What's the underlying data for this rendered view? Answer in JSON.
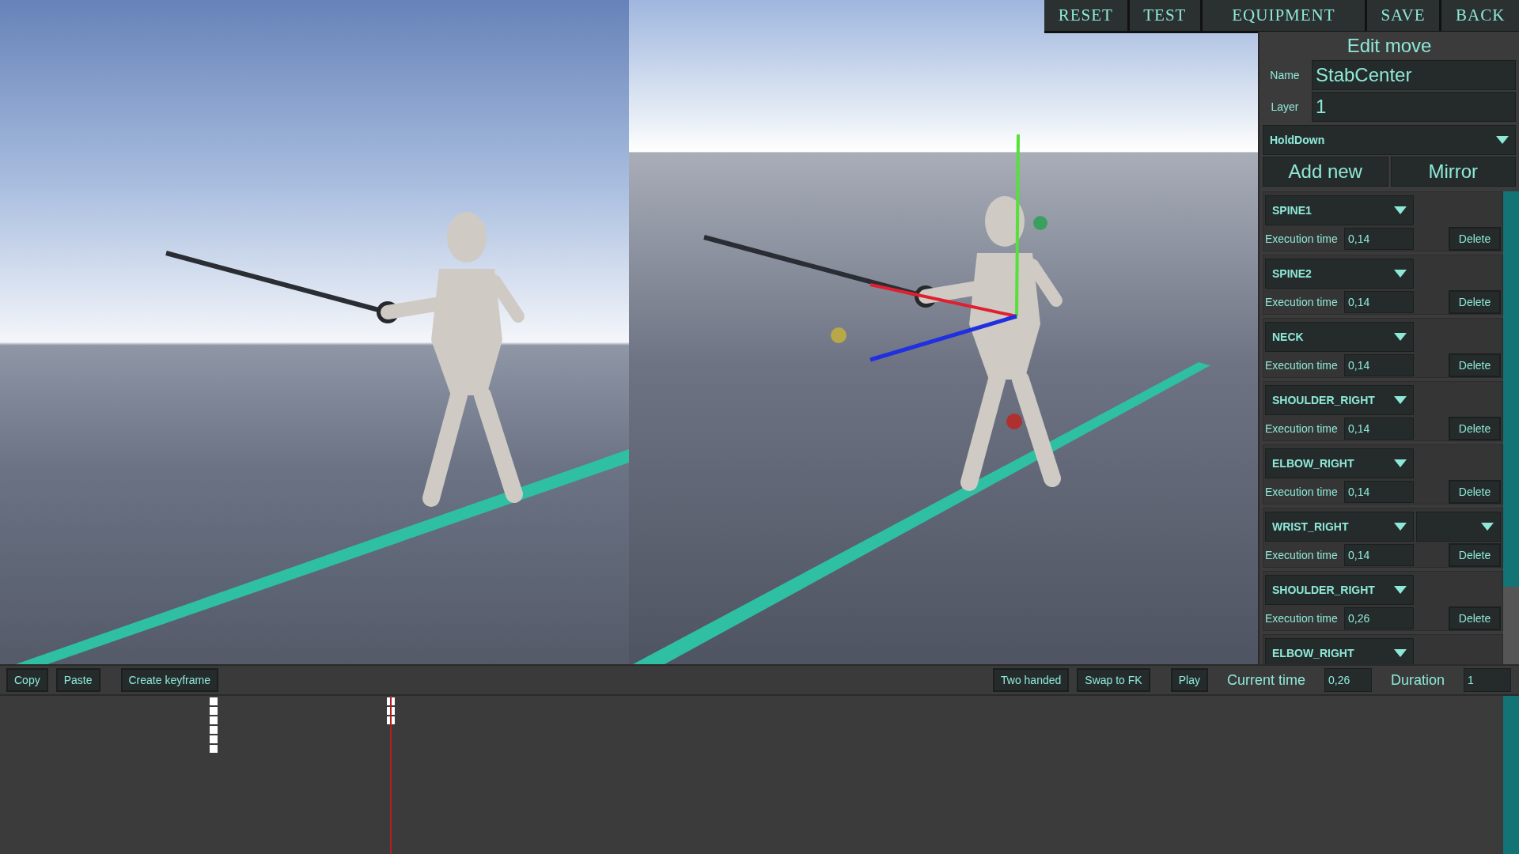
{
  "top_menu": [
    {
      "label": "RESET"
    },
    {
      "label": "TEST"
    },
    {
      "label": "EQUIPMENT"
    },
    {
      "label": "SAVE"
    },
    {
      "label": "BACK"
    }
  ],
  "edit_panel": {
    "title": "Edit move",
    "name_label": "Name",
    "name_value": "StabCenter",
    "layer_label": "Layer",
    "layer_value": "1",
    "mode_dropdown": "HoldDown",
    "buttons": [
      "Add new",
      "Mirror"
    ],
    "keyframes": [
      {
        "bone": "SPINE1",
        "time_label": "Execution time",
        "time": "0,14",
        "delete": "Delete",
        "extra_dropdown": false
      },
      {
        "bone": "SPINE2",
        "time_label": "Execution time",
        "time": "0,14",
        "delete": "Delete",
        "extra_dropdown": false
      },
      {
        "bone": "NECK",
        "time_label": "Execution time",
        "time": "0,14",
        "delete": "Delete",
        "extra_dropdown": false
      },
      {
        "bone": "SHOULDER_RIGHT",
        "time_label": "Execution time",
        "time": "0,14",
        "delete": "Delete",
        "extra_dropdown": false
      },
      {
        "bone": "ELBOW_RIGHT",
        "time_label": "Execution time",
        "time": "0,14",
        "delete": "Delete",
        "extra_dropdown": false
      },
      {
        "bone": "WRIST_RIGHT",
        "time_label": "Execution time",
        "time": "0,14",
        "delete": "Delete",
        "extra_dropdown": true
      },
      {
        "bone": "SHOULDER_RIGHT",
        "time_label": "Execution time",
        "time": "0,26",
        "delete": "Delete",
        "extra_dropdown": false
      },
      {
        "bone": "ELBOW_RIGHT"
      }
    ]
  },
  "toolbar": {
    "left_buttons": [
      "Copy",
      "Paste",
      "Create keyframe"
    ],
    "right_buttons": [
      "Two handed",
      "Swap to FK",
      "Play"
    ],
    "current_time_label": "Current time",
    "current_time": "0,26",
    "duration_label": "Duration",
    "duration": "1"
  },
  "timeline": {
    "playhead": {
      "level": 0.26
    }
  }
}
